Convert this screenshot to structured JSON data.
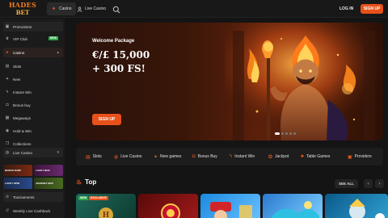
{
  "brand": {
    "line1": "HADES",
    "line2": "BET"
  },
  "header": {
    "tabs": [
      {
        "label": "Casino",
        "icon": "casino-icon",
        "active": true
      },
      {
        "label": "Live Casino",
        "icon": "user-icon",
        "active": false
      }
    ],
    "login_label": "LOG IN",
    "signup_label": "SIGN UP"
  },
  "sidebar": {
    "items": [
      {
        "label": "Promotions",
        "icon": "gift-icon"
      },
      {
        "label": "VIP Club",
        "icon": "crown-icon",
        "badge": "NEW"
      },
      {
        "label": "Casino",
        "icon": "casino-icon"
      },
      {
        "label": "Slots",
        "icon": "slots-icon"
      },
      {
        "label": "New",
        "icon": "sparkle-icon"
      },
      {
        "label": "Instant Win",
        "icon": "lightning-icon"
      },
      {
        "label": "Bonus buy",
        "icon": "bag-icon"
      },
      {
        "label": "Megaways",
        "icon": "grid-icon"
      },
      {
        "label": "Hold & Win",
        "icon": "coin-icon"
      },
      {
        "label": "Collections",
        "icon": "layers-icon"
      },
      {
        "label": "Live Casino",
        "icon": "user-icon"
      },
      {
        "label": "Tournaments",
        "icon": "trophy-icon"
      },
      {
        "label": "Weekly Live Cashback",
        "icon": "cashback-icon"
      }
    ],
    "promo_chips": [
      "BONUS SHOP",
      "LUCKY BOX",
      "LUCKY SPIN",
      "JOURNEY MAP"
    ]
  },
  "banner": {
    "welcome": "Welcome Package",
    "offer_line1": "€/£ 15,000",
    "offer_line2": "+ 300 FS!",
    "cta_label": "SIGN UP"
  },
  "categories": [
    {
      "label": "Slots",
      "icon": "slots-icon"
    },
    {
      "label": "Live Casino",
      "icon": "user-icon"
    },
    {
      "label": "New games",
      "icon": "sparkle-icon"
    },
    {
      "label": "Bonus Buy",
      "icon": "bag-icon"
    },
    {
      "label": "Instant Win",
      "icon": "lightning-icon"
    },
    {
      "label": "Jackpot",
      "icon": "jackpot-icon"
    },
    {
      "label": "Table Games",
      "icon": "table-icon"
    },
    {
      "label": "Providers",
      "icon": "providers-icon"
    }
  ],
  "top_section": {
    "title": "Top",
    "see_all_label": "SEE ALL",
    "card_badges": [
      "NEW",
      "EXCLUSIVE"
    ]
  },
  "colors": {
    "accent": "#e8511a",
    "background": "#141414",
    "sidebar": "#1b1b1b",
    "new_badge": "#2ea84a"
  }
}
